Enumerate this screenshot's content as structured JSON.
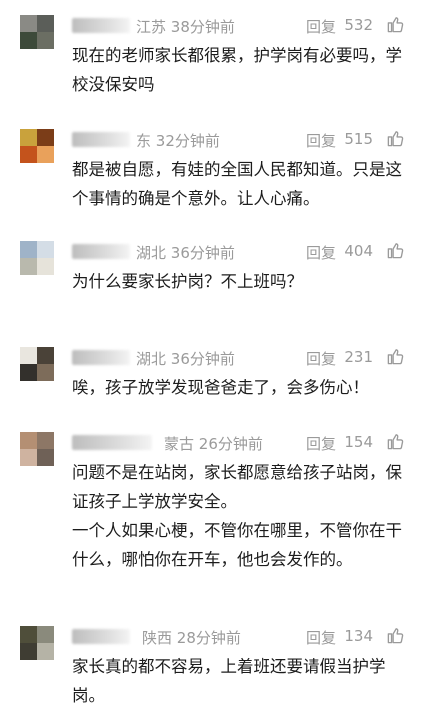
{
  "comments": [
    {
      "location": "江苏",
      "time": "38分钟前",
      "reply": "回复",
      "likes": "532",
      "text": "现在的老师家长都很累，护学岗有必要吗，学校没保安吗",
      "avatar": [
        "#8a8a85",
        "#5b5e59",
        "#3d4a3a",
        "#6b6e63"
      ]
    },
    {
      "location": "东",
      "time": "32分钟前",
      "reply": "回复",
      "likes": "515",
      "text": "都是被自愿，有娃的全国人民都知道。只是这个事情的确是个意外。让人心痛。",
      "avatar": [
        "#c9a23c",
        "#7b3d18",
        "#c4531c",
        "#e9a15b"
      ]
    },
    {
      "location": "湖北",
      "time": "36分钟前",
      "reply": "回复",
      "likes": "404",
      "text": "为什么要家长护岗？不上班吗？",
      "avatar": [
        "#9fb3c8",
        "#d4dde6",
        "#b9b9ad",
        "#e6e3da"
      ]
    },
    {
      "location": "湖北",
      "time": "36分钟前",
      "reply": "回复",
      "likes": "231",
      "text": "唉，孩子放学发现爸爸走了，会多伤心！",
      "avatar": [
        "#e9e6df",
        "#4a4238",
        "#33302c",
        "#7d6c5a"
      ]
    },
    {
      "location": "蒙古",
      "time": "26分钟前",
      "reply": "回复",
      "likes": "154",
      "text": "问题不是在站岗，家长都愿意给孩子站岗，保证孩子上学放学安全。\n一个人如果心梗，不管你在哪里，不管你在干什么，哪怕你在开车，他也会发作的。",
      "avatar": [
        "#b48f73",
        "#8d7766",
        "#cfb3a0",
        "#6f6157"
      ]
    },
    {
      "location": "陕西",
      "time": "28分钟前",
      "reply": "回复",
      "likes": "134",
      "text": "家长真的都不容易，上着班还要请假当护学岗。",
      "avatar": [
        "#4f4e3a",
        "#8a8a7c",
        "#3f3d33",
        "#b5b3a6"
      ]
    }
  ],
  "icons": {
    "like": "thumbs-up-icon"
  }
}
